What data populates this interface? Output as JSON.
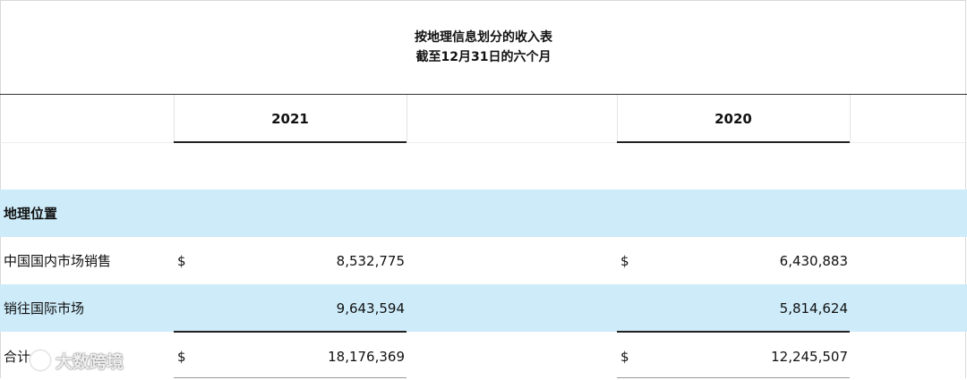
{
  "header": {
    "title": "按地理信息划分的收入表",
    "subtitle": "截至12月31日的六个月"
  },
  "columns": {
    "year_1": "2021",
    "year_2": "2020"
  },
  "section": {
    "label": "地理位置"
  },
  "rows": [
    {
      "label": "中国国内市场销售",
      "currency_1": "$",
      "value_1": "8,532,775",
      "currency_2": "$",
      "value_2": "6,430,883"
    },
    {
      "label": "销往国际市场",
      "currency_1": "",
      "value_1": "9,643,594",
      "currency_2": "",
      "value_2": "5,814,624"
    },
    {
      "label": "合计",
      "currency_1": "$",
      "value_1": "18,176,369",
      "currency_2": "$",
      "value_2": "12,245,507"
    }
  ],
  "watermark": {
    "text": "大数跨境"
  }
}
